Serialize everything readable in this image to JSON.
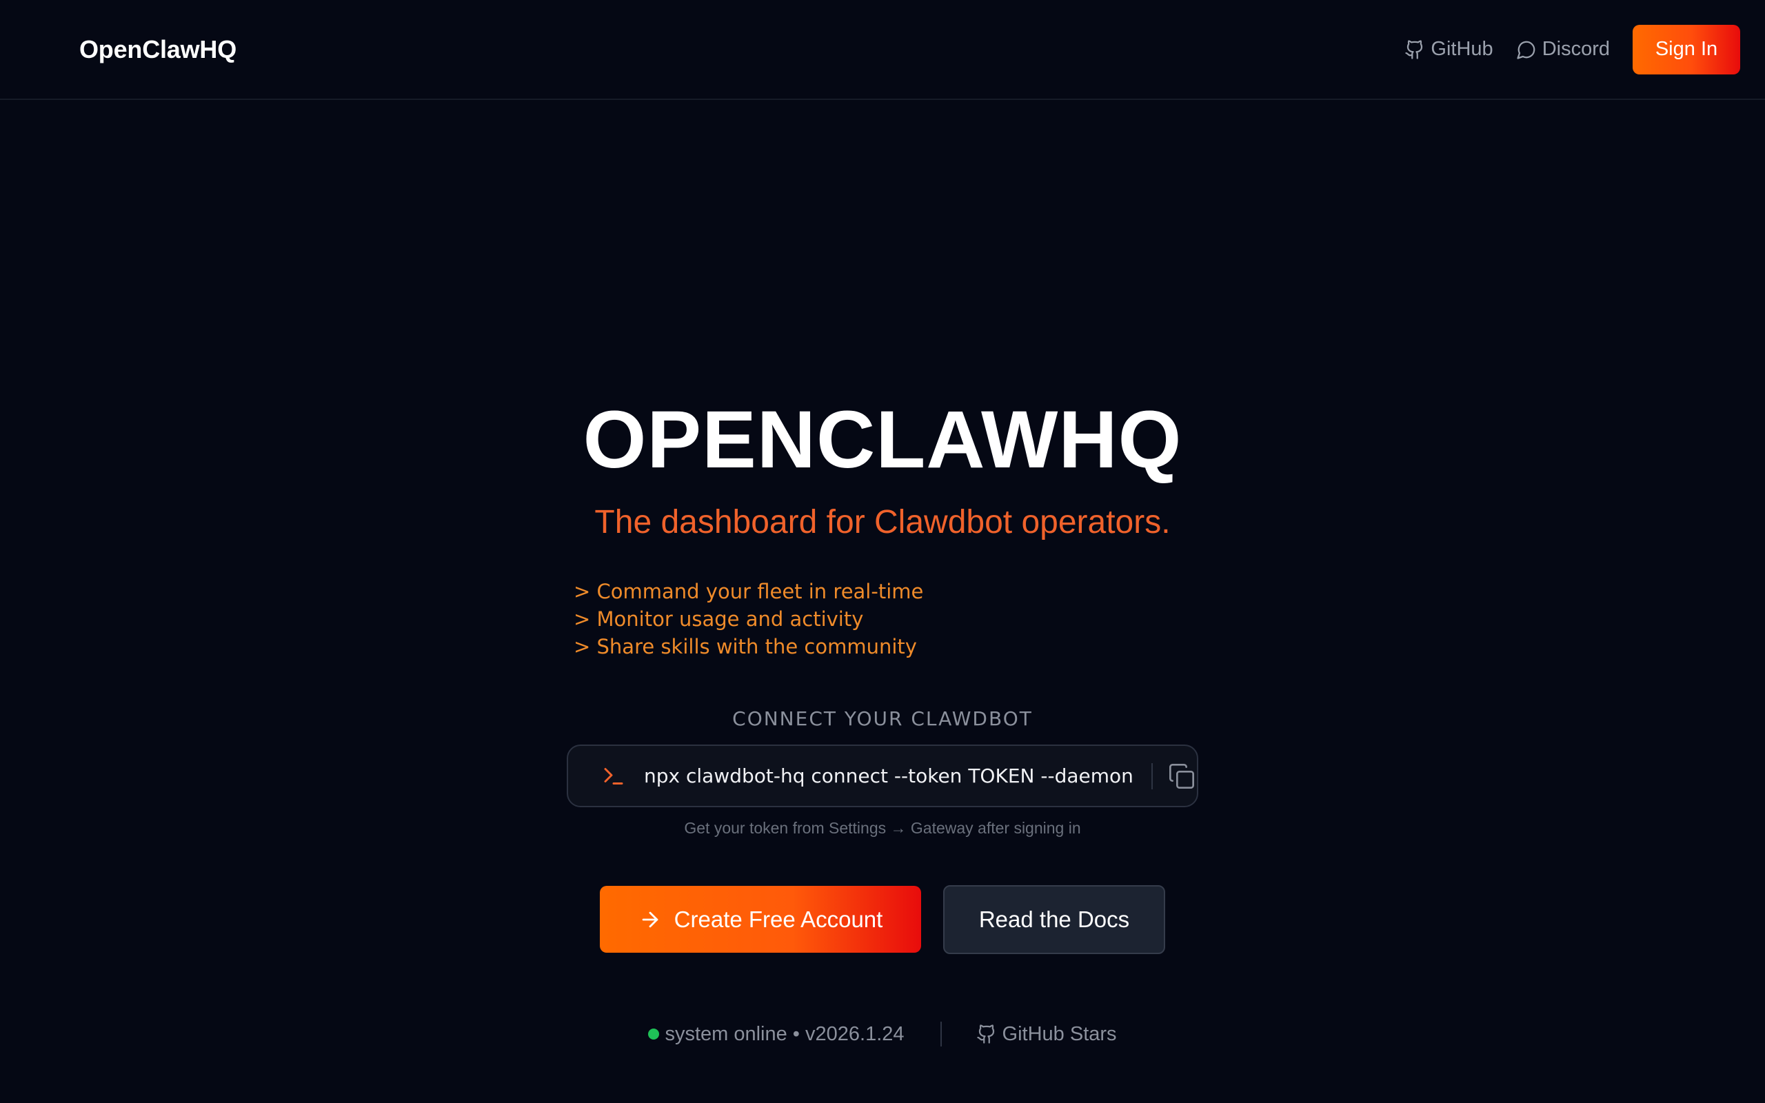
{
  "header": {
    "logo": "OpenClawHQ",
    "nav": {
      "github_label": "GitHub",
      "discord_label": "Discord",
      "signin_label": "Sign In"
    }
  },
  "hero": {
    "title": "OPENCLAWHQ",
    "subtitle": "The dashboard for Clawdbot operators.",
    "features": [
      "> Command your fleet in real-time",
      "> Monitor usage and activity",
      "> Share skills with the community"
    ]
  },
  "connect": {
    "label": "CONNECT YOUR CLAWDBOT",
    "command": "npx clawdbot-hq connect --token TOKEN --daemon",
    "hint": "Get your token from Settings → Gateway after signing in",
    "prompt_icon": "terminal-prompt-icon",
    "copy_icon": "copy-icon"
  },
  "actions": {
    "primary_label": "Create Free Account",
    "secondary_label": "Read the Docs"
  },
  "status": {
    "text": "system online • v2026.1.24",
    "github_stars_label": "GitHub Stars"
  },
  "colors": {
    "background": "#050814",
    "accent": "#f0622b",
    "feature_text": "#ef8b2a",
    "status_online": "#1fc157",
    "gradient_start": "#ff6a00",
    "gradient_end": "#e80c0c"
  }
}
